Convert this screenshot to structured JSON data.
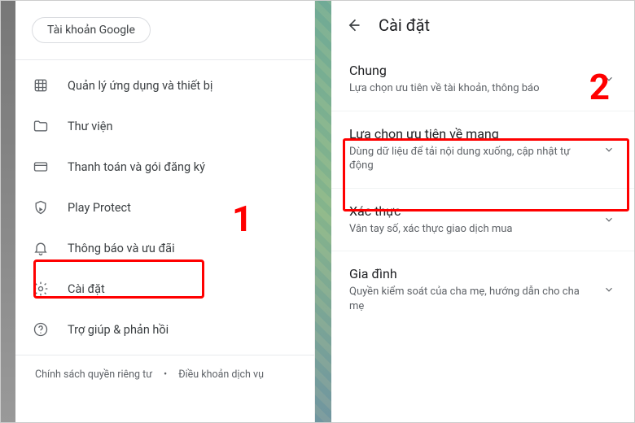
{
  "left": {
    "account_chip": "Tài khoản Google",
    "menu": [
      {
        "icon": "grid-icon",
        "label": "Quản lý ứng dụng và thiết bị"
      },
      {
        "icon": "folder-icon",
        "label": "Thư viện"
      },
      {
        "icon": "card-icon",
        "label": "Thanh toán và gói đăng ký"
      },
      {
        "icon": "shield-icon",
        "label": "Play Protect"
      },
      {
        "icon": "bell-icon",
        "label": "Thông báo và ưu đãi"
      },
      {
        "icon": "gear-icon",
        "label": "Cài đặt"
      },
      {
        "icon": "help-icon",
        "label": "Trợ giúp & phản hồi"
      }
    ],
    "footer": {
      "privacy": "Chính sách quyền riêng tư",
      "terms": "Điều khoản dịch vụ"
    }
  },
  "right": {
    "title": "Cài đặt",
    "items": [
      {
        "title": "Chung",
        "sub": "Lựa chọn ưu tiên về tài khoản, thông báo"
      },
      {
        "title": "Lựa chọn ưu tiên về mạng",
        "sub": "Dùng dữ liệu để tải nội dung xuống, cập nhật tự động"
      },
      {
        "title": "Xác thực",
        "sub": "Vân tay số, xác thực giao dịch mua"
      },
      {
        "title": "Gia đình",
        "sub": "Quyền kiểm soát của cha mẹ, hướng dẫn cho cha mẹ"
      }
    ]
  },
  "annotations": {
    "one": "1",
    "two": "2"
  }
}
